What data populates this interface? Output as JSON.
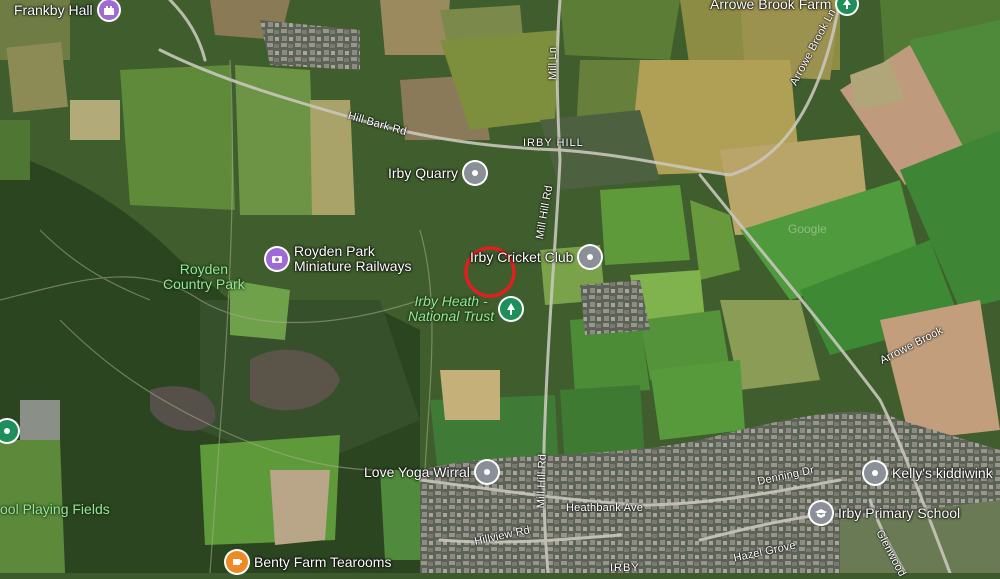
{
  "map": {
    "places": {
      "frankby_hall": "Frankby Hall",
      "arrowe_brook_farm": "Arrowe Brook Farm",
      "irby_quarry": "Irby Quarry",
      "irby_hill": "IRBY HILL",
      "royden_railways": [
        "Royden Park",
        "Miniature Railways"
      ],
      "royden_country_park": [
        "Royden",
        "Country Park"
      ],
      "irby_cricket_club": "Irby Cricket Club",
      "irby_heath": [
        "Irby Heath -",
        "National Trust"
      ],
      "love_yoga": "Love Yoga Wirral",
      "playing_fields": "ool Playing Fields",
      "benty_farm": "Benty Farm Tearooms",
      "kellys": "Kelly's kiddiwink",
      "irby_primary": "Irby Primary School",
      "irby_bottom": "IRBY",
      "watermark": "Google"
    },
    "roads": {
      "hill_bark": "Hill Bark Rd",
      "mill_ln": "Mill Ln",
      "mill_hill_upper": "Mill Hill Rd",
      "mill_hill_lower": "Mill Hill Rd",
      "arrowe_brook_ln": "Arrowe Brook Ln",
      "arrowe_brook": "Arrowe Brook",
      "heathbank": "Heathbank Ave",
      "denning": "Denning Dr",
      "hillview": "Hillview Rd",
      "hazel_grove": "Hazel Grove",
      "glenwood": "Glenwood"
    },
    "colors": {
      "grey_pin": "#8a8f98",
      "green_pin": "#1e8e5a",
      "purple_pin": "#a06ad6",
      "orange_pin": "#f08a24",
      "marker": "#e02020"
    },
    "icons": {
      "frankby_hall": "castle-icon",
      "arrowe_brook_farm": "tree-icon",
      "irby_quarry": "location-pin-icon",
      "royden_railways": "camera-icon",
      "irby_cricket_club": "location-pin-icon",
      "irby_heath": "tree-icon",
      "love_yoga": "location-pin-icon",
      "playing_fields": "tree-icon",
      "benty_farm": "cup-icon",
      "kellys": "location-pin-icon",
      "irby_primary": "school-icon"
    }
  }
}
